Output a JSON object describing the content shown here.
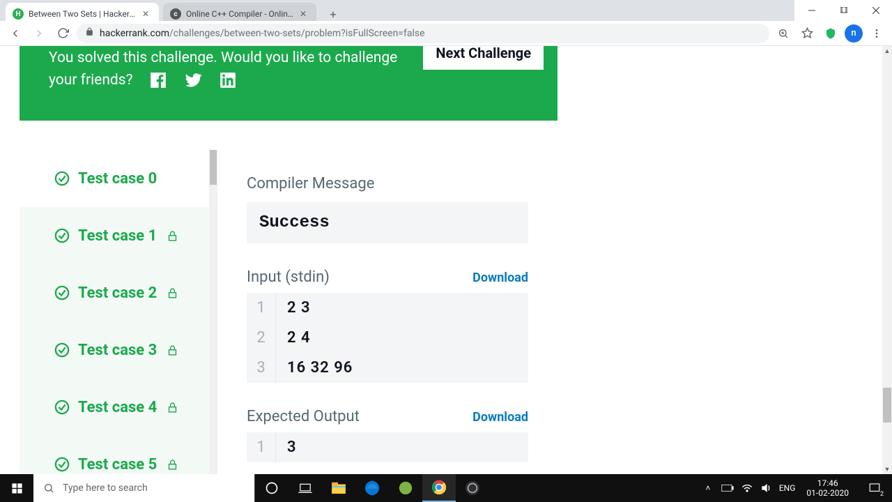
{
  "window": {
    "tabs": [
      {
        "title": "Between Two Sets | HackerRank",
        "favicon": "H",
        "active": true
      },
      {
        "title": "Online C++ Compiler - Online C",
        "favicon": "c",
        "active": false
      }
    ]
  },
  "addressbar": {
    "domain": "hackerrank.com",
    "path": "/challenges/between-two-sets/problem?isFullScreen=false",
    "avatar_letter": "n"
  },
  "banner": {
    "text_line1": "You solved this challenge. Would you like to challenge",
    "text_line2": "your friends?",
    "next_button": "Next Challenge"
  },
  "testcases": [
    {
      "label": "Test case 0",
      "locked": false,
      "active": true
    },
    {
      "label": "Test case 1",
      "locked": true,
      "active": false
    },
    {
      "label": "Test case 2",
      "locked": true,
      "active": false
    },
    {
      "label": "Test case 3",
      "locked": true,
      "active": false
    },
    {
      "label": "Test case 4",
      "locked": true,
      "active": false
    },
    {
      "label": "Test case 5",
      "locked": true,
      "active": false
    }
  ],
  "detail": {
    "compiler_title": "Compiler Message",
    "compiler_msg": "Success",
    "input_title": "Input (stdin)",
    "download_label": "Download",
    "input_lines": [
      "2 3",
      "2 4",
      "16 32 96"
    ],
    "output_title": "Expected Output",
    "output_lines": [
      "3"
    ]
  },
  "taskbar": {
    "search_placeholder": "Type here to search",
    "lang": "ENG",
    "time": "17:46",
    "date": "01-02-2020",
    "notif_count": "2"
  }
}
